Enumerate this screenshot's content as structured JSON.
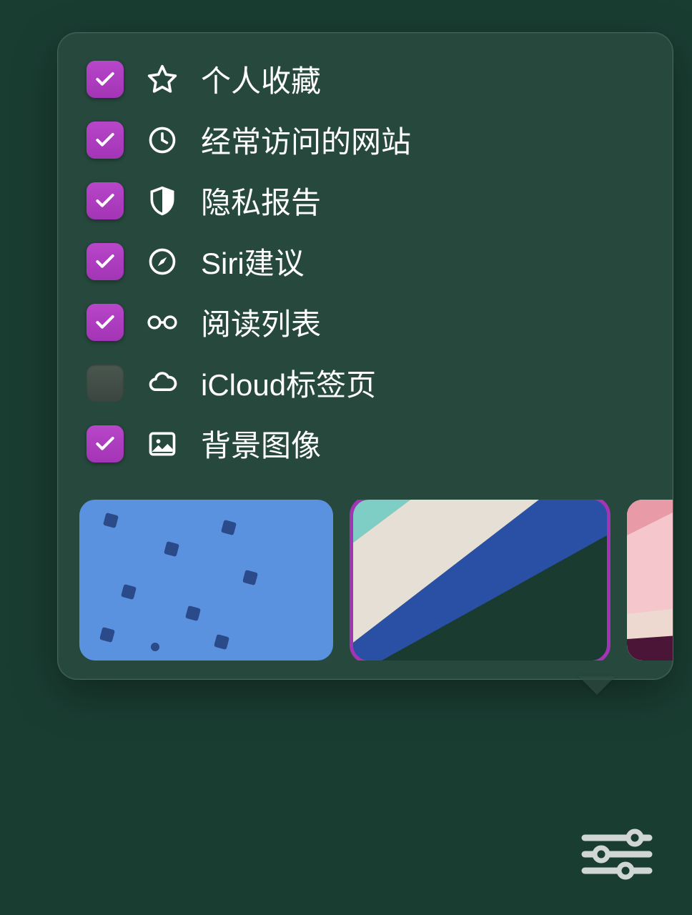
{
  "options": [
    {
      "checked": true,
      "icon": "star",
      "label": "个人收藏"
    },
    {
      "checked": true,
      "icon": "clock",
      "label": "经常访问的网站"
    },
    {
      "checked": true,
      "icon": "shield",
      "label": "隐私报告"
    },
    {
      "checked": true,
      "icon": "compass",
      "label": "Siri建议"
    },
    {
      "checked": true,
      "icon": "glasses",
      "label": "阅读列表"
    },
    {
      "checked": false,
      "icon": "cloud",
      "label": "iCloud标签页"
    },
    {
      "checked": true,
      "icon": "image",
      "label": "背景图像"
    }
  ],
  "thumbnails": {
    "selected_index": 1
  },
  "colors": {
    "accent": "#a235b5",
    "background": "#1a3d32"
  }
}
